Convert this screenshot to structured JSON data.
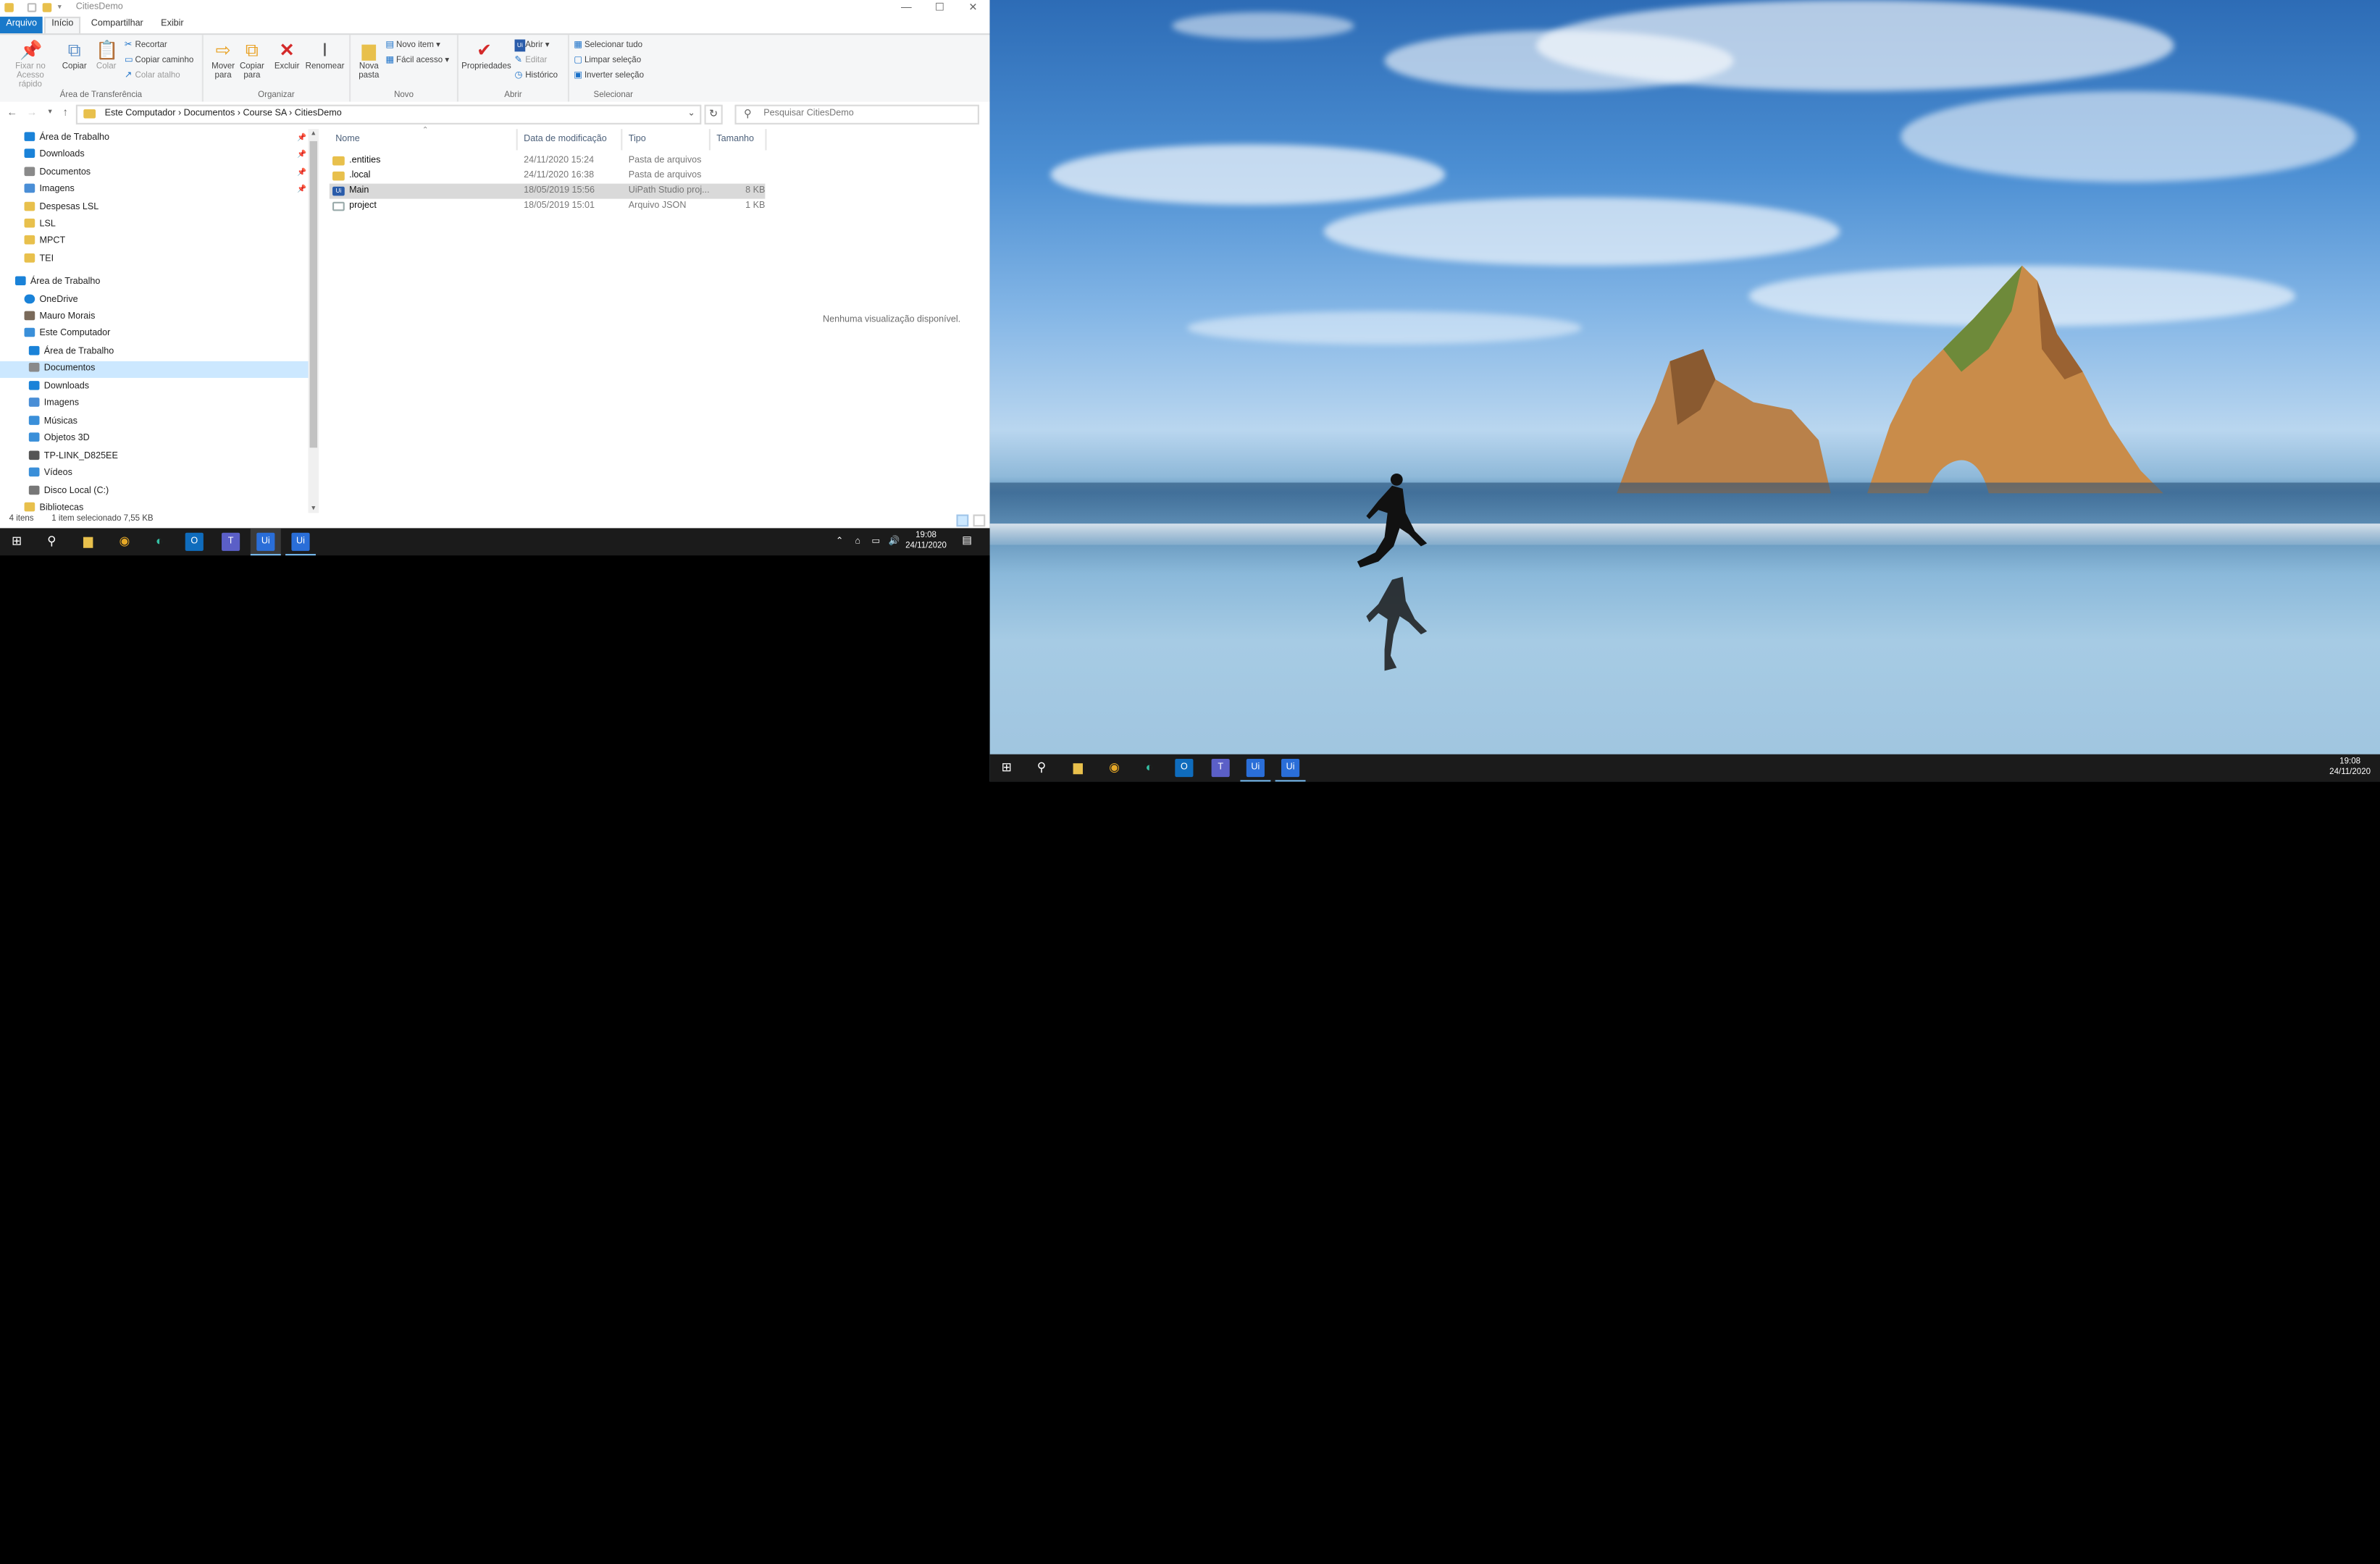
{
  "window": {
    "title": "CitiesDemo",
    "controls": {
      "minimize": "—",
      "maximize": "☐",
      "close": "✕"
    }
  },
  "ribbon_tabs": [
    "Arquivo",
    "Início",
    "Compartilhar",
    "Exibir"
  ],
  "ribbon": {
    "clipboard": {
      "pin_label_1": "Fixar no",
      "pin_label_2": "Acesso rápido",
      "copy": "Copiar",
      "paste": "Colar",
      "cut": "Recortar",
      "copy_path": "Copiar caminho",
      "paste_shortcut": "Colar atalho",
      "group": "Área de Transferência"
    },
    "organize": {
      "move_1": "Mover",
      "move_2": "para",
      "copy_1": "Copiar",
      "copy_2": "para",
      "delete": "Excluir",
      "rename": "Renomear",
      "group": "Organizar"
    },
    "new": {
      "new_folder_1": "Nova",
      "new_folder_2": "pasta",
      "new_item": "Novo item",
      "easy_access": "Fácil acesso",
      "group": "Novo"
    },
    "open": {
      "properties": "Propriedades",
      "open": "Abrir",
      "edit": "Editar",
      "history": "Histórico",
      "group": "Abrir"
    },
    "select": {
      "select_all": "Selecionar tudo",
      "select_none": "Limpar seleção",
      "invert": "Inverter seleção",
      "group": "Selecionar"
    }
  },
  "address": {
    "crumbs": "Este Computador  ›  Documentos  ›  Course SA  ›  CitiesDemo",
    "search_placeholder": "Pesquisar CitiesDemo"
  },
  "nav_pane": [
    {
      "label": "Área de Trabalho",
      "pinned": true,
      "color": "#1a82d8"
    },
    {
      "label": "Downloads",
      "pinned": true,
      "color": "#1a82d8"
    },
    {
      "label": "Documentos",
      "pinned": true,
      "color": "#8a8a8a"
    },
    {
      "label": "Imagens",
      "pinned": true,
      "color": "#4a8ed6"
    },
    {
      "label": "Despesas LSL",
      "color": "#e8c04c"
    },
    {
      "label": "LSL",
      "color": "#e8c04c"
    },
    {
      "label": "MPCT",
      "color": "#e8c04c"
    },
    {
      "label": "TEI",
      "color": "#e8c04c"
    },
    {
      "label": "Área de Trabalho",
      "color": "#1a82d8"
    },
    {
      "label": "OneDrive",
      "color": "#1a82d8"
    },
    {
      "label": "Mauro Morais",
      "color": "#7a6a5a"
    },
    {
      "label": "Este Computador",
      "color": "#3a8fd9"
    },
    {
      "label": "Área de Trabalho",
      "color": "#1a82d8"
    },
    {
      "label": "Documentos",
      "selected": true,
      "color": "#8a8a8a"
    },
    {
      "label": "Downloads",
      "color": "#1a82d8"
    },
    {
      "label": "Imagens",
      "color": "#4a8ed6"
    },
    {
      "label": "Músicas",
      "color": "#3a8fd9"
    },
    {
      "label": "Objetos 3D",
      "color": "#3a8fd9"
    },
    {
      "label": "TP-LINK_D825EE",
      "color": "#555555"
    },
    {
      "label": "Vídeos",
      "color": "#3a8fd9"
    },
    {
      "label": "Disco Local (C:)",
      "color": "#777777"
    },
    {
      "label": "Bibliotecas",
      "color": "#e8c04c"
    }
  ],
  "columns": [
    "Nome",
    "Data de modificação",
    "Tipo",
    "Tamanho"
  ],
  "files": [
    {
      "name": ".entities",
      "date": "24/11/2020 15:24",
      "type": "Pasta de arquivos",
      "size": "",
      "icon": "folder"
    },
    {
      "name": ".local",
      "date": "24/11/2020 16:38",
      "type": "Pasta de arquivos",
      "size": "",
      "icon": "folder"
    },
    {
      "name": "Main",
      "date": "18/05/2019 15:56",
      "type": "UiPath Studio proj...",
      "size": "8 KB",
      "icon": "ui",
      "selected": true
    },
    {
      "name": "project",
      "date": "18/05/2019 15:01",
      "type": "Arquivo JSON",
      "size": "1 KB",
      "icon": "doc"
    }
  ],
  "preview": {
    "message": "Nenhuma visualização disponível."
  },
  "status": {
    "items": "4 itens",
    "selected": "1 item selecionado  7,55 KB"
  },
  "taskbar1": {
    "time": "19:08",
    "date": "24/11/2020",
    "ui_label": "Ui"
  },
  "taskbar2": {
    "time": "19:08",
    "date": "24/11/2020",
    "ui_label": "Ui"
  }
}
